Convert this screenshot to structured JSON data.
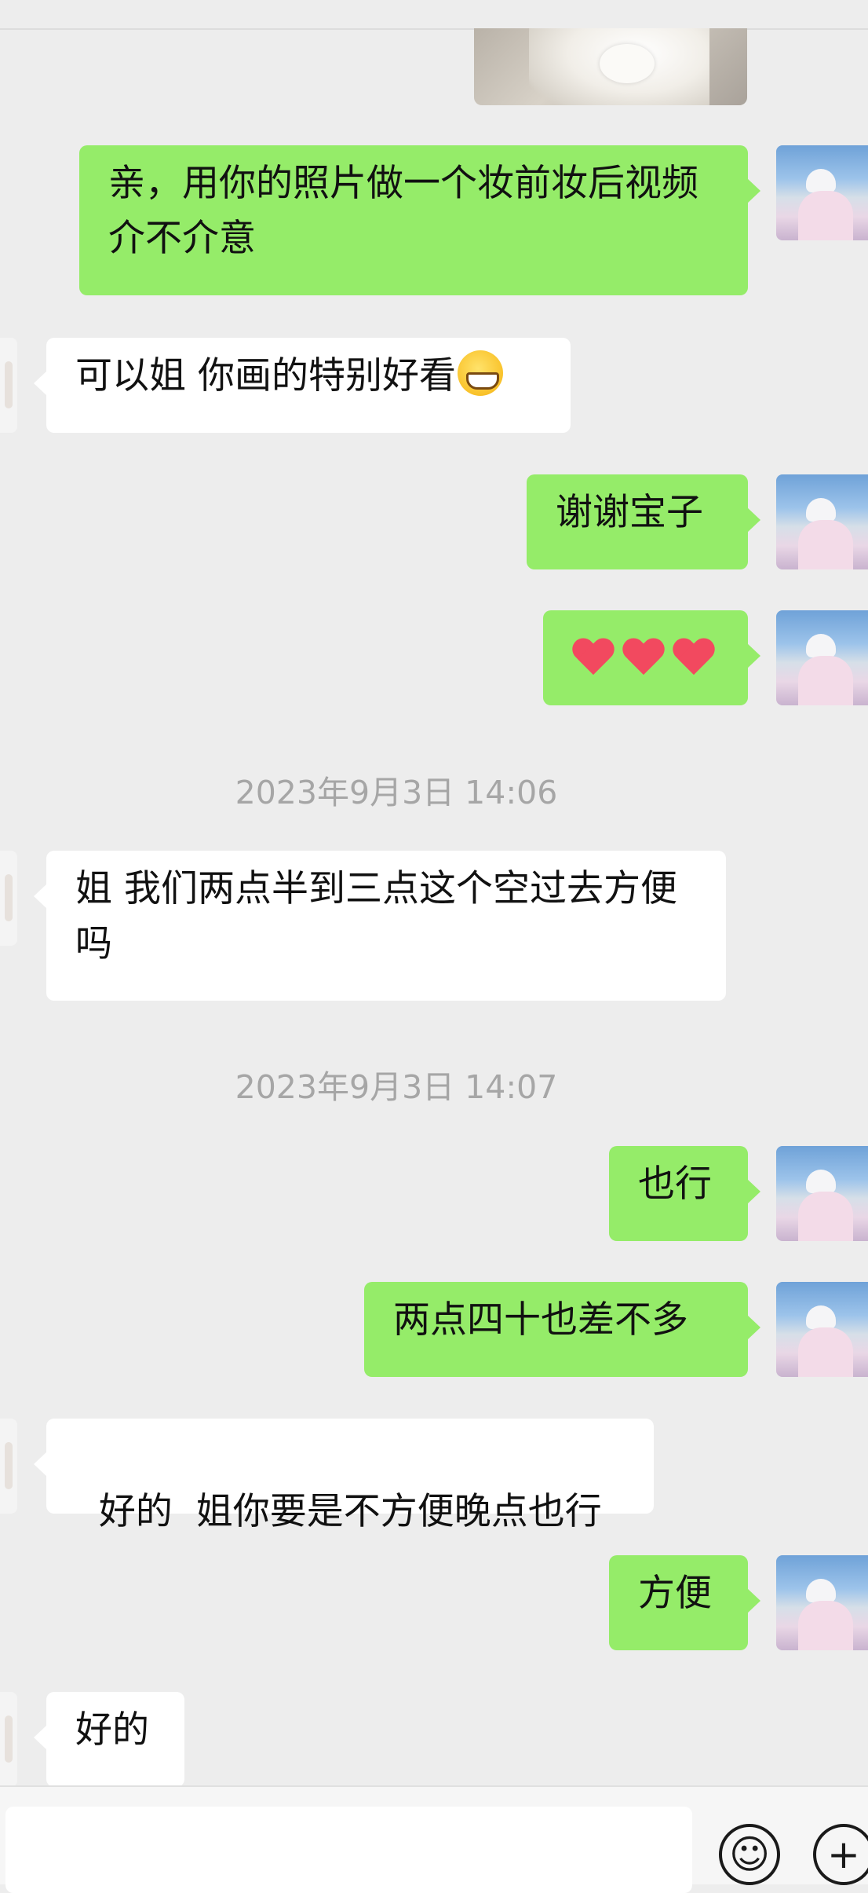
{
  "messages": [
    {
      "side": "out",
      "text": "亲，用你的照片做一个妆前妆后视频介不介意"
    },
    {
      "side": "in",
      "text": "可以姐 你画的特别好看",
      "emoji": "grinning-face-emoji"
    },
    {
      "side": "out",
      "text": "谢谢宝子"
    },
    {
      "side": "out",
      "emoji": "red-heart-emoji x3"
    },
    {
      "timestamp": "2023年9月3日 14:06"
    },
    {
      "side": "in",
      "text": "姐 我们两点半到三点这个空过去方便吗"
    },
    {
      "timestamp": "2023年9月3日 14:07"
    },
    {
      "side": "out",
      "text": "也行"
    },
    {
      "side": "out",
      "text": "两点四十也差不多"
    },
    {
      "side": "in",
      "text": "好的  姐你要是不方便晚点也行"
    },
    {
      "side": "out",
      "text": "方便"
    },
    {
      "side": "in",
      "text": "好的"
    }
  ],
  "input_bar": {
    "emoji_icon": "smiley-icon",
    "plus_icon": "plus-icon"
  },
  "colors": {
    "outgoing_bubble": "#95ec69",
    "incoming_bubble": "#ffffff",
    "background": "#ededed",
    "timestamp": "#a6a6a6"
  }
}
